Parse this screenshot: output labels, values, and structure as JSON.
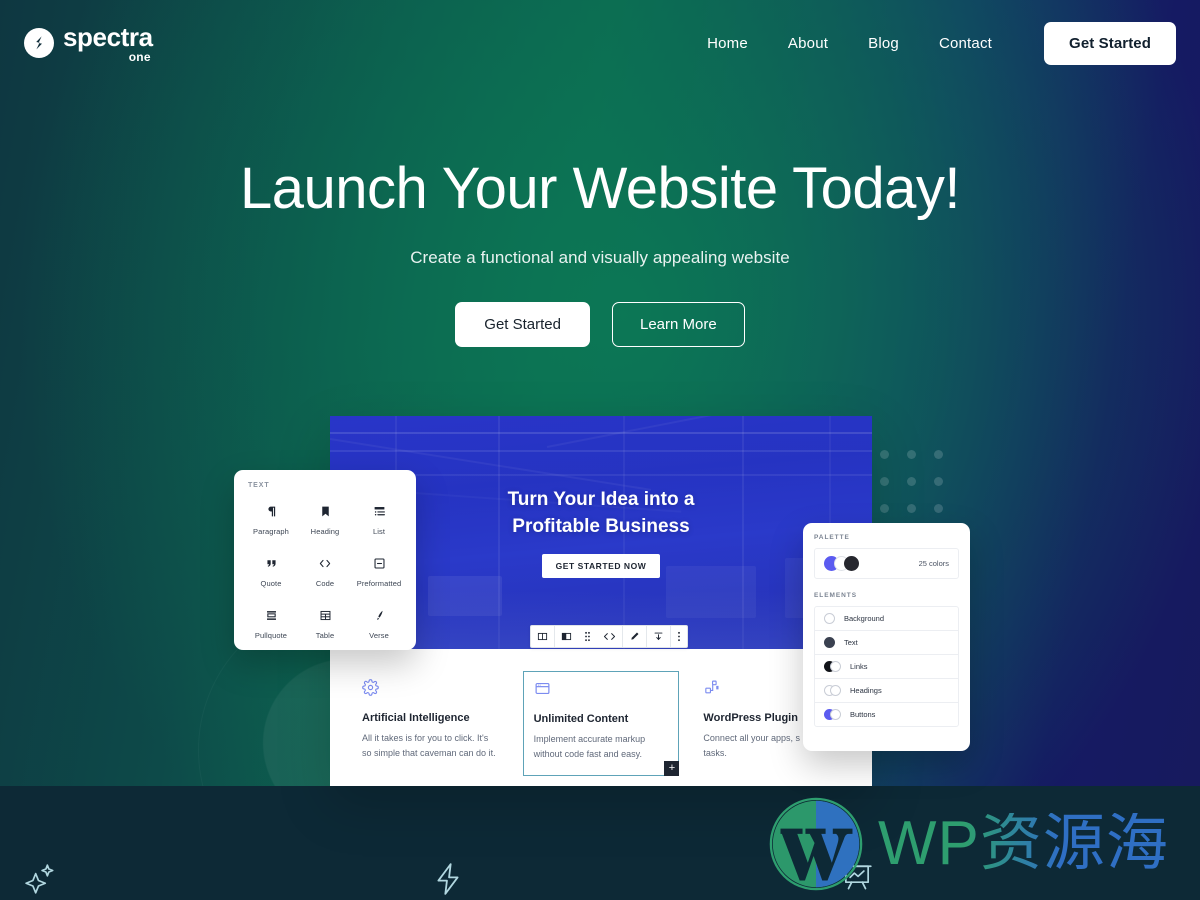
{
  "brand": {
    "name": "spectra",
    "sub": "one",
    "logo_icon": "spectra-s-icon"
  },
  "nav": {
    "links": [
      {
        "label": "Home"
      },
      {
        "label": "About"
      },
      {
        "label": "Blog"
      },
      {
        "label": "Contact"
      }
    ],
    "cta": "Get Started"
  },
  "hero": {
    "title": "Launch Your Website Today!",
    "subtitle": "Create a functional and visually appealing website",
    "primary_button": "Get Started",
    "secondary_button": "Learn More",
    "gradient_from": "#0e3741",
    "gradient_mid": "#0c6b52",
    "gradient_to": "#171a5e"
  },
  "mockup": {
    "banner": {
      "headline_line1": "Turn Your Idea into a",
      "headline_line2": "Profitable Business",
      "button": "GET STARTED NOW"
    },
    "toolbar_icons": [
      "columns-icon",
      "column-layout-icon",
      "drag-handle-icon",
      "code-icon",
      "pencil-icon",
      "align-icon",
      "more-options-icon"
    ],
    "features": [
      {
        "icon": "gear-icon",
        "title": "Artificial Intelligence",
        "desc": "All it takes is for you to click. It's so simple that caveman can do it.",
        "selected": false
      },
      {
        "icon": "browser-window-icon",
        "title": "Unlimited Content",
        "desc": "Implement accurate markup without code fast and easy.",
        "selected": true
      },
      {
        "icon": "plugin-icon",
        "title": "WordPress Plugin",
        "desc": "Connect all your apps, s repetitive tasks.",
        "selected": false
      }
    ]
  },
  "inserter_card": {
    "section_label": "TEXT",
    "blocks": [
      {
        "name": "Paragraph",
        "icon": "paragraph-icon"
      },
      {
        "name": "Heading",
        "icon": "heading-bookmark-icon"
      },
      {
        "name": "List",
        "icon": "list-icon"
      },
      {
        "name": "Quote",
        "icon": "quote-icon"
      },
      {
        "name": "Code",
        "icon": "code-icon"
      },
      {
        "name": "Preformatted",
        "icon": "preformatted-icon"
      },
      {
        "name": "Pullquote",
        "icon": "pullquote-icon"
      },
      {
        "name": "Table",
        "icon": "table-icon"
      },
      {
        "name": "Verse",
        "icon": "verse-pen-icon"
      }
    ]
  },
  "palette_card": {
    "palette_label": "PALETTE",
    "color_count": "25 colors",
    "swatches": [
      "#5b5bf0",
      "#ffffff",
      "#26272e"
    ],
    "elements_label": "ELEMENTS",
    "elements": [
      {
        "name": "Background",
        "style": "single",
        "color": "#ffffff"
      },
      {
        "name": "Text",
        "style": "single",
        "color": "#3a4150"
      },
      {
        "name": "Links",
        "style": "dual",
        "color": "#111318"
      },
      {
        "name": "Headings",
        "style": "dual",
        "color": "#ffffff"
      },
      {
        "name": "Buttons",
        "style": "dual",
        "color": "#5b5bf0"
      }
    ]
  },
  "bottom_band": {
    "icons": [
      "sparkle-icon",
      "lightning-bolt-icon",
      "chart-presentation-icon"
    ],
    "background": "#0d2936"
  },
  "watermark": {
    "text": "WP资源海",
    "logo_icon": "wordpress-logo-icon",
    "color_green": "#2e9e6f",
    "color_blue": "#2f6fc4"
  }
}
